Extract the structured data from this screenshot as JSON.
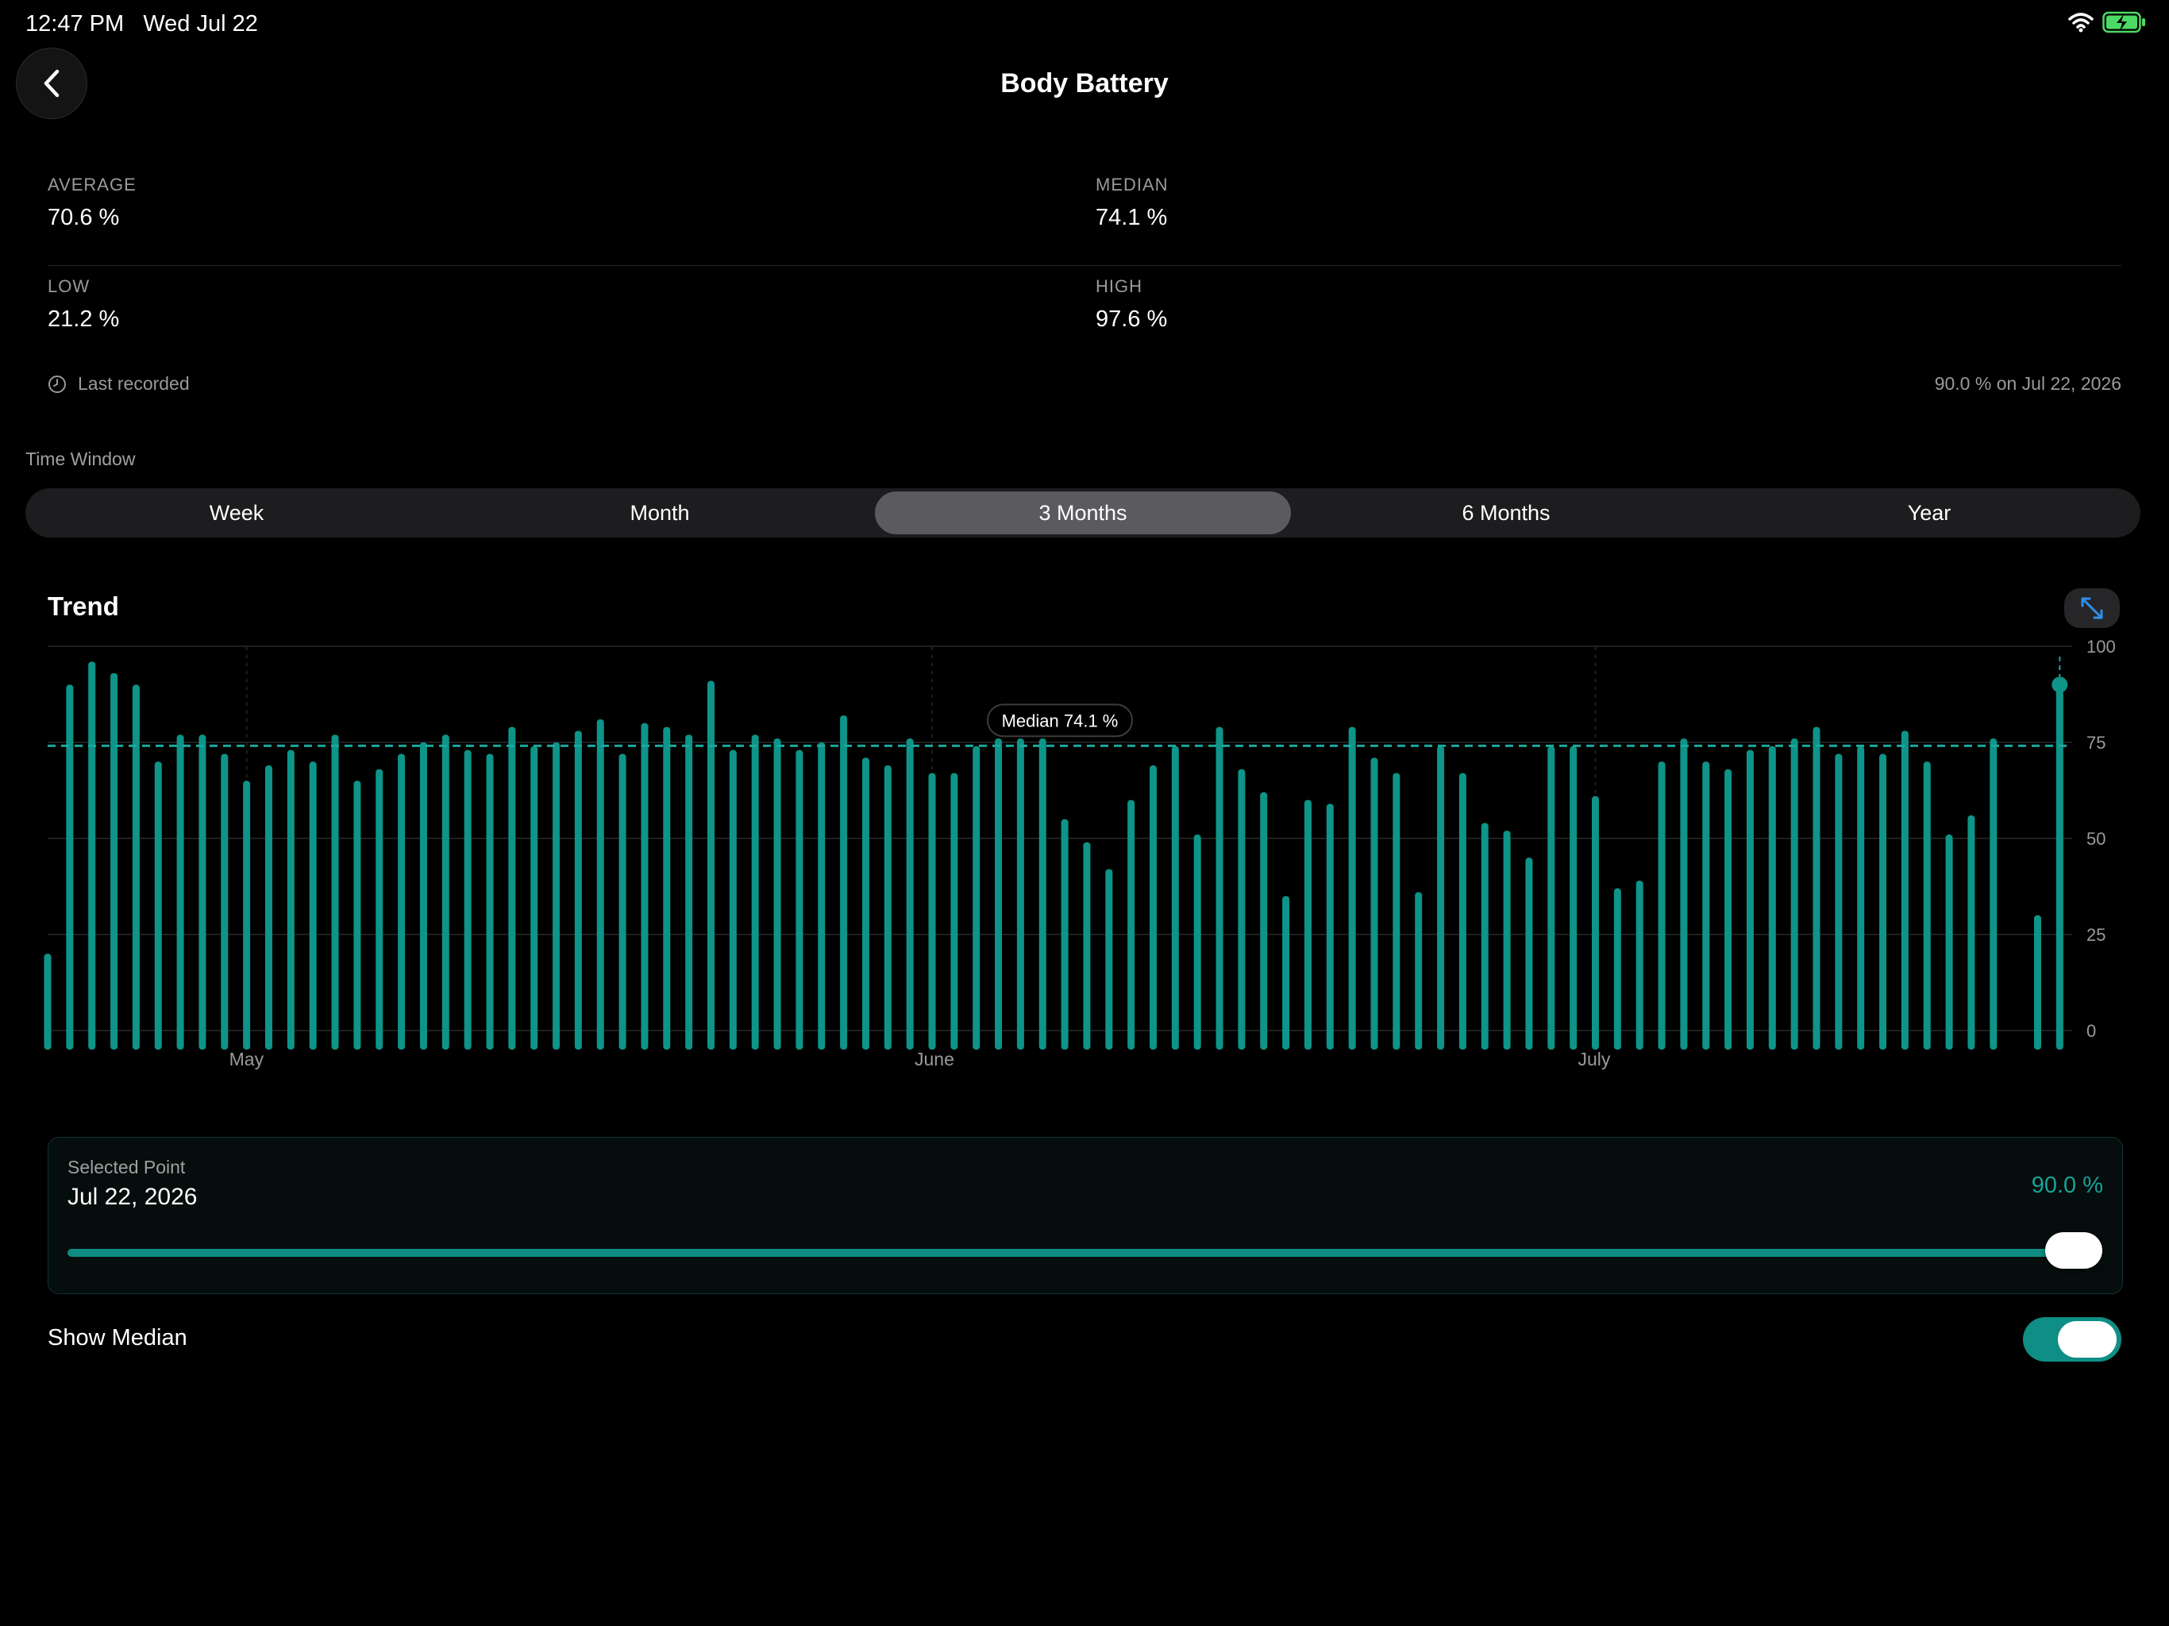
{
  "status_bar": {
    "time": "12:47 PM",
    "date": "Wed Jul 22"
  },
  "header": {
    "title": "Body Battery",
    "back_icon": "chevron-left-icon"
  },
  "stats": {
    "average": {
      "label": "AVERAGE",
      "value": "70.6 %"
    },
    "median": {
      "label": "MEDIAN",
      "value": "74.1 %"
    },
    "low": {
      "label": "LOW",
      "value": "21.2 %"
    },
    "high": {
      "label": "HIGH",
      "value": "97.6 %"
    }
  },
  "last_recorded": {
    "label": "Last recorded",
    "value": "90.0 % on Jul 22, 2026"
  },
  "time_window": {
    "label": "Time Window",
    "options": [
      "Week",
      "Month",
      "3 Months",
      "6 Months",
      "Year"
    ],
    "selected": "3 Months"
  },
  "trend": {
    "title": "Trend",
    "median_label": "Median 74.1 %"
  },
  "colors": {
    "accent": "#0e9488",
    "median_line": "#1aa89c",
    "background": "#000000"
  },
  "chart_data": {
    "type": "bar",
    "y_ticks": [
      "100",
      "75",
      "50",
      "25",
      "0"
    ],
    "ylim": [
      0,
      100
    ],
    "x_month_labels": [
      "May",
      "June",
      "July"
    ],
    "median": 74.1,
    "selected_index": 91,
    "values": [
      20,
      90,
      96,
      93,
      90,
      70,
      77,
      77,
      72,
      65,
      69,
      73,
      70,
      77,
      65,
      68,
      72,
      75,
      77,
      73,
      72,
      79,
      74,
      75,
      78,
      81,
      72,
      80,
      79,
      77,
      91,
      73,
      77,
      76,
      73,
      75,
      82,
      71,
      69,
      76,
      67,
      67,
      74,
      76,
      76,
      76,
      55,
      49,
      42,
      60,
      69,
      74,
      51,
      79,
      68,
      62,
      35,
      60,
      59,
      79,
      71,
      67,
      36,
      74,
      67,
      54,
      52,
      45,
      74,
      74,
      61,
      37,
      39,
      70,
      76,
      70,
      68,
      73,
      74,
      76,
      79,
      72,
      74,
      72,
      78,
      70,
      51,
      56,
      76,
      null,
      30,
      90
    ],
    "month_label_indices": [
      9,
      40,
      70
    ]
  },
  "selected_point": {
    "label": "Selected Point",
    "date": "Jul 22, 2026",
    "value": "90.0 %",
    "fraction": 1.0
  },
  "show_median": {
    "label": "Show Median",
    "enabled": true
  }
}
